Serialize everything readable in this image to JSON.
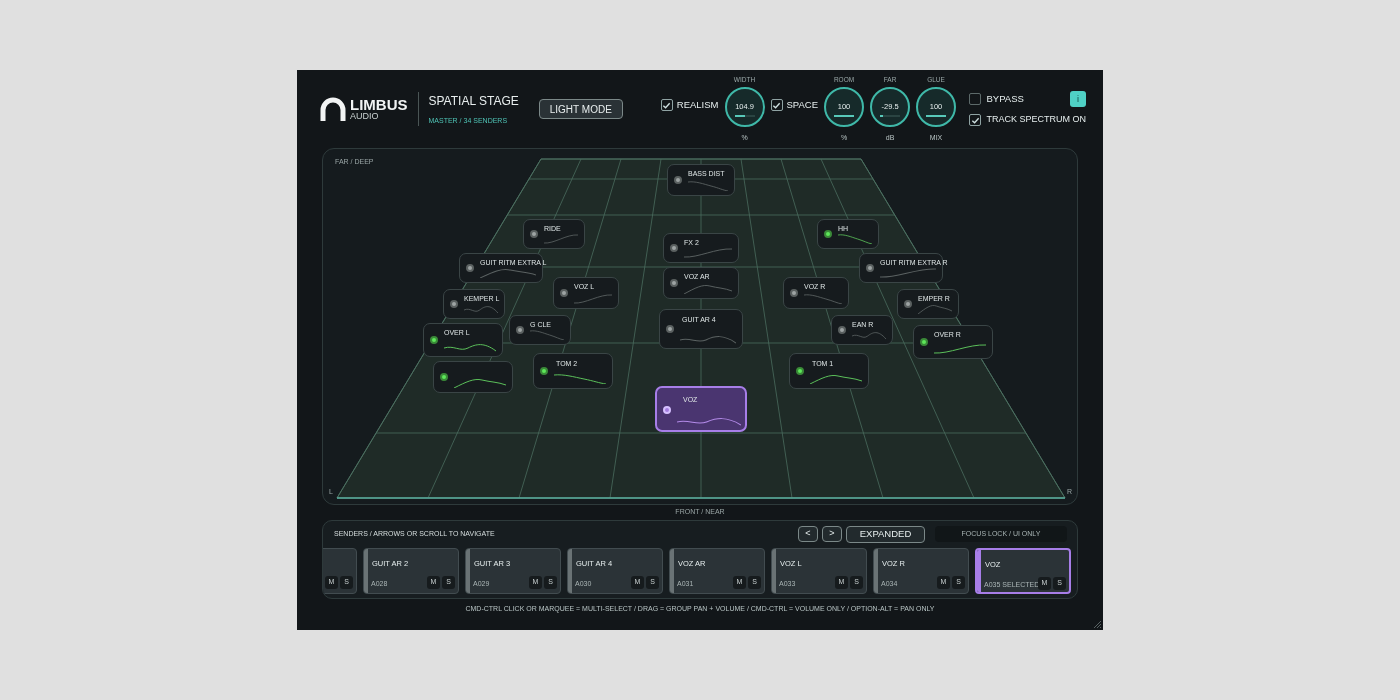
{
  "brand": {
    "name": "LIMBUS",
    "sub": "AUDIO"
  },
  "plugin": {
    "title": "SPATIAL STAGE",
    "subtitle": "MASTER / 34 SENDERS",
    "mode_button": "LIGHT MODE"
  },
  "controls": [
    {
      "kind": "checkbox",
      "label": "REALISM",
      "checked": true
    },
    {
      "kind": "knob",
      "caption": "WIDTH",
      "value": "104.9",
      "unit": "%",
      "level": 0.5
    },
    {
      "kind": "checkbox",
      "label": "SPACE",
      "checked": true
    },
    {
      "kind": "knob",
      "caption": "ROOM",
      "value": "100",
      "unit": "%",
      "level": 1
    },
    {
      "kind": "knob",
      "caption": "FAR",
      "value": "-29.5",
      "unit": "dB",
      "level": 0.15
    },
    {
      "kind": "knob",
      "caption": "GLUE",
      "value": "100",
      "unit": "MIX",
      "level": 1
    }
  ],
  "bypass": {
    "label": "BYPASS",
    "checked": false
  },
  "info_button": "i",
  "track_spectrum": {
    "label": "TRACK SPECTRUM ON",
    "checked": true
  },
  "stage": {
    "top_label": "FAR / DEEP",
    "left_marker": "L",
    "right_marker": "R",
    "bottom_label": "FRONT / NEAR",
    "nodes": [
      {
        "name": "BASS DIST",
        "active": false,
        "selected": false
      },
      {
        "name": "RIDE",
        "active": false,
        "selected": false
      },
      {
        "name": "GUIT RITM EXTRA L",
        "active": false,
        "selected": false
      },
      {
        "name": "KEMPER L",
        "active": false,
        "selected": false
      },
      {
        "name": "G CLE",
        "active": false,
        "selected": false
      },
      {
        "name": "VOZ  L",
        "active": false,
        "selected": false
      },
      {
        "active": true,
        "selected": false
      },
      {
        "name": "OVER L",
        "active": true,
        "selected": false
      },
      {
        "name": "TOM 2",
        "active": true,
        "selected": false
      },
      {
        "name": "FX 2",
        "active": false,
        "selected": false
      },
      {
        "name": "VOZ AR",
        "active": false,
        "selected": false
      },
      {
        "name": "GUIT AR 4",
        "active": false,
        "selected": false
      },
      {
        "name": "HH",
        "active": true,
        "selected": false
      },
      {
        "name": "GUIT RITM EXTRA R",
        "active": false,
        "selected": false
      },
      {
        "name": "EMPER R",
        "active": false,
        "selected": false
      },
      {
        "name": "EAN R",
        "active": false,
        "selected": false
      },
      {
        "name": "VOZ R",
        "active": false,
        "selected": false
      },
      {
        "name": "OVER R",
        "active": true,
        "selected": false
      },
      {
        "name": "TOM 1",
        "active": true,
        "selected": false
      },
      {
        "name": "VOZ",
        "active": false,
        "selected": true
      }
    ]
  },
  "senders": {
    "title": "SENDERS / ARROWS OR SCROLL TO NAVIGATE",
    "prev": "<",
    "next": ">",
    "view_button": "EXPANDED",
    "focus_lock": "FOCUS LOCK / UI ONLY",
    "strips": [
      {
        "mute": "M",
        "solo": "S",
        "selected": false
      },
      {
        "name": "GUIT AR 2",
        "code": "A028",
        "mute": "M",
        "solo": "S",
        "selected": false
      },
      {
        "name": "GUIT AR 3",
        "code": "A029",
        "mute": "M",
        "solo": "S",
        "selected": false
      },
      {
        "name": "GUIT AR 4",
        "code": "A030",
        "mute": "M",
        "solo": "S",
        "selected": false
      },
      {
        "name": "VOZ AR",
        "code": "A031",
        "mute": "M",
        "solo": "S",
        "selected": false
      },
      {
        "name": "VOZ  L",
        "code": "A033",
        "mute": "M",
        "solo": "S",
        "selected": false
      },
      {
        "name": "VOZ R",
        "code": "A034",
        "mute": "M",
        "solo": "S",
        "selected": false
      },
      {
        "name": "VOZ",
        "code": "A035 SELECTED",
        "mute": "M",
        "solo": "S",
        "selected": true
      }
    ]
  },
  "hint": "CMD-CTRL CLICK OR MARQUEE = MULTI-SELECT / DRAG = GROUP PAN + VOLUME / CMD-CTRL = VOLUME ONLY / OPTION-ALT = PAN ONLY"
}
